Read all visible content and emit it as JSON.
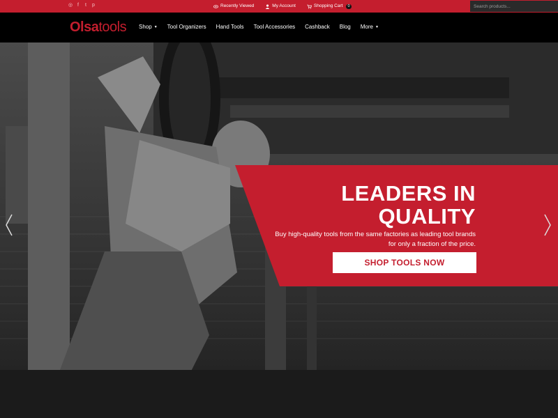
{
  "topbar": {
    "social_icons": [
      "instagram-icon",
      "facebook-icon",
      "twitter-icon",
      "pinterest-icon"
    ],
    "social_glyphs": [
      "◎",
      "f",
      "t",
      "p"
    ],
    "links": [
      {
        "label": "Recently Viewed",
        "icon": "eye-icon"
      },
      {
        "label": "My Account",
        "icon": "user-icon"
      },
      {
        "label": "Shopping Cart",
        "icon": "cart-icon",
        "badge": "0"
      }
    ],
    "search_placeholder": "Search products..."
  },
  "nav": {
    "logo_part1": "Olsa",
    "logo_part2": "tools",
    "items": [
      {
        "label": "Shop",
        "dropdown": true
      },
      {
        "label": "Tool Organizers",
        "dropdown": false
      },
      {
        "label": "Hand Tools",
        "dropdown": false
      },
      {
        "label": "Tool Accessories",
        "dropdown": false
      },
      {
        "label": "Cashback",
        "dropdown": false
      },
      {
        "label": "Blog",
        "dropdown": false
      },
      {
        "label": "More",
        "dropdown": true
      }
    ]
  },
  "hero": {
    "headline_line1": "LEADERS IN",
    "headline_line2": "QUALITY",
    "subtext": "Buy high-quality tools from the same factories as leading tool brands for only a fraction of the price.",
    "cta_label": "SHOP TOOLS NOW"
  },
  "colors": {
    "brand_red": "#c41e2e",
    "nav_bg": "#000000",
    "white": "#ffffff"
  }
}
